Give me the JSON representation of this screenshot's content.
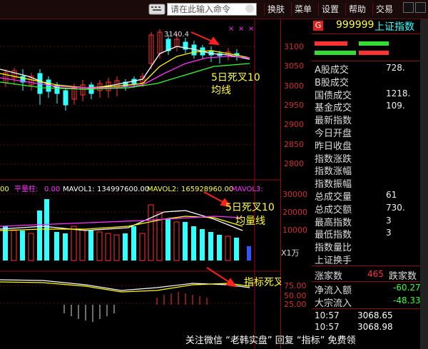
{
  "topbar": {
    "command_placeholder": "请在此输入命令",
    "menus": [
      "换肤",
      "菜单",
      "设置",
      "帮助",
      "交易"
    ]
  },
  "price_axis": [
    "3100",
    "3050",
    "3000",
    "2950",
    "2900",
    "2850",
    "2800"
  ],
  "price_annotation": {
    "peak": "3140.4",
    "cross_text": "5日死叉10",
    "cross_text2": "均线"
  },
  "volume_legend": {
    "flat_label": "平量柱:",
    "flat_value": "0.00",
    "mavol1": "MAVOL1:",
    "mavol1_value": "134997600.00",
    "mavol2": "MAVOL2:",
    "mavol2_value": "165928960.00",
    "mavol3": "MAVOL3:",
    "leading_text": "00"
  },
  "volume_axis": [
    "30000",
    "20000",
    "10000"
  ],
  "volume_unit": "X1万",
  "volume_annotation": {
    "line1": "5日死叉10",
    "line2": "均量线"
  },
  "indicator_axis": [
    "75.00",
    "50.00",
    "25.00"
  ],
  "indicator_annotation": "指标死叉",
  "index_header": {
    "badge": "G",
    "code": "999999",
    "name": "上证指数"
  },
  "stats": [
    {
      "label": "A股成交",
      "value": "728."
    },
    {
      "label": "B股成交",
      "value": ""
    },
    {
      "label": "国债成交",
      "value": "1218."
    },
    {
      "label": "基金成交",
      "value": "109."
    },
    {
      "label": "最新指数",
      "value": ""
    },
    {
      "label": "今日开盘",
      "value": ""
    },
    {
      "label": "昨日收盘",
      "value": ""
    },
    {
      "label": "指数涨跌",
      "value": ""
    },
    {
      "label": "指数涨幅",
      "value": ""
    },
    {
      "label": "指数振幅",
      "value": ""
    },
    {
      "label": "总成交量",
      "value": "61"
    },
    {
      "label": "总成交额",
      "value": "730."
    },
    {
      "label": "最高指数",
      "value": "3"
    },
    {
      "label": "最低指数",
      "value": "3"
    },
    {
      "label": "指数量比",
      "value": ""
    },
    {
      "label": "上证换手",
      "value": ""
    }
  ],
  "updown": {
    "up_label": "涨家数",
    "up_value": "465",
    "down_label": "跌家数"
  },
  "flows": [
    {
      "label": "净流入额",
      "value": "-60.27"
    },
    {
      "label": "大宗流入",
      "value": "-48.33"
    }
  ],
  "ticks": [
    {
      "time": "10:57",
      "price": "3068.65"
    },
    {
      "time": "10:57",
      "price": "3068.98"
    }
  ],
  "watermark": "关注微信 “老韩实盘” 回复 “指标” 免费领",
  "colors": {
    "up": "#ff3333",
    "down": "#33ffff",
    "ma5": "#ffffff",
    "ma10": "#ffff00",
    "ma20": "#ff33ff",
    "ma30": "#33ff33"
  }
}
